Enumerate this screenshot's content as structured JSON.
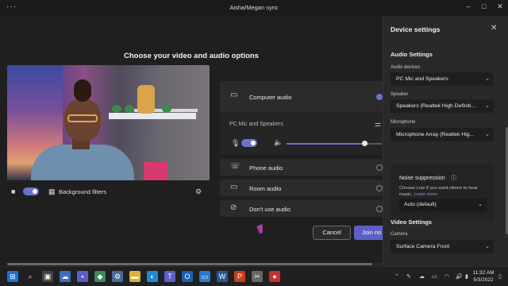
{
  "window": {
    "title": "Aisha/Megan sync",
    "more_icon": "ellipsis-icon",
    "minimize": "–",
    "maximize": "□",
    "close": "✕"
  },
  "stage": {
    "heading": "Choose your video and audio options",
    "video_toggle_on": true,
    "background_filters_label": "Background filters"
  },
  "audio_options": {
    "computer_audio": {
      "label": "Computer audio",
      "selected": true
    },
    "device_name": "PC Mic and Speakers",
    "mic_toggle_on": true,
    "volume_level": 0.82,
    "phone_audio": {
      "label": "Phone audio",
      "selected": false
    },
    "room_audio": {
      "label": "Room audio",
      "selected": false
    },
    "dont_use_audio": {
      "label": "Don't use audio",
      "selected": false
    }
  },
  "actions": {
    "cancel_label": "Cancel",
    "join_label": "Join no"
  },
  "device_settings": {
    "title": "Device settings",
    "audio_settings_heading": "Audio Settings",
    "audio_devices_label": "Audio devices",
    "audio_devices_value": "PC Mic and Speakers",
    "speaker_label": "Speaker",
    "speaker_value": "Speakers (Realtek High Definiti...",
    "microphone_label": "Microphone",
    "microphone_value": "Microphone Array (Realtek Hig...",
    "noise_suppression_title": "Noise suppression",
    "noise_suppression_desc": "Choose Low if you want others to hear music.",
    "learn_more": "Learn more",
    "noise_suppression_value": "Auto (default)",
    "video_settings_heading": "Video Settings",
    "camera_label": "Camera",
    "camera_value": "Surface Camera Front"
  },
  "taskbar": {
    "clock_time": "11:32 AM",
    "clock_date": "5/3/2022",
    "colors": {
      "accent": "#5b5fc7",
      "toggle": "#6b71d0",
      "taskbar": "#202020"
    }
  }
}
